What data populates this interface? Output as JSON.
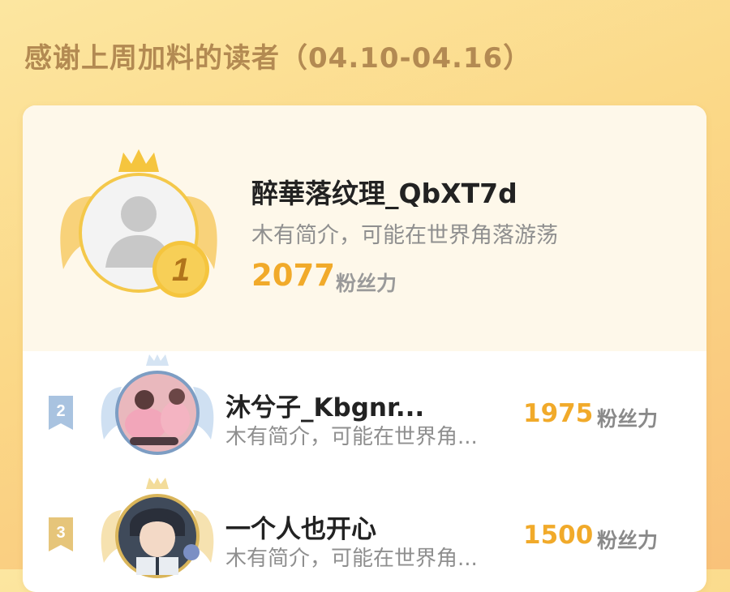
{
  "header": {
    "title": "感谢上周加料的读者（04.10-04.16）"
  },
  "rank1": {
    "rank": "1",
    "name": "醉華落纹理_QbXT7d",
    "bio": "木有简介，可能在世界角落游荡",
    "score": "2077",
    "unit": "粉丝力"
  },
  "rows": [
    {
      "rank": "2",
      "name": "沐兮子_Kbgnr...",
      "bio": "木有简介，可能在世界角...",
      "score": "1975",
      "unit": "粉丝力"
    },
    {
      "rank": "3",
      "name": "一个人也开心",
      "bio": "木有简介，可能在世界角...",
      "score": "1500",
      "unit": "粉丝力"
    }
  ],
  "colors": {
    "accent": "#f1aa2a",
    "gold": "#f5c53e",
    "silver": "#a9c3e0",
    "bronze": "#e6c57a",
    "title": "#b38a52"
  }
}
